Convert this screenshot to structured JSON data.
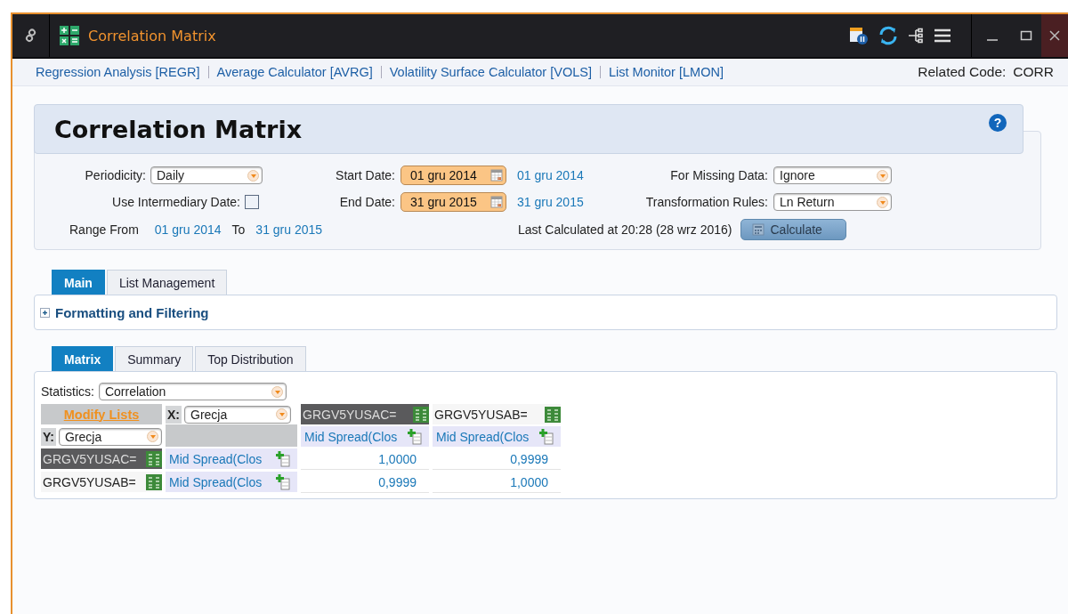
{
  "window": {
    "title": "Correlation Matrix"
  },
  "related_links": [
    "Regression Analysis [REGR]",
    "Average Calculator [AVRG]",
    "Volatility Surface Calculator [VOLS]",
    "List Monitor [LMON]"
  ],
  "related_code": {
    "label": "Related Code:",
    "value": "CORR"
  },
  "page_title": "Correlation Matrix",
  "help": "?",
  "form": {
    "periodicity": {
      "label": "Periodicity:",
      "value": "Daily"
    },
    "intermediary": {
      "label": "Use Intermediary Date:",
      "checked": false
    },
    "start_date": {
      "label": "Start Date:",
      "value": "01 gru 2014",
      "link": "01 gru 2014"
    },
    "end_date": {
      "label": "End Date:",
      "value": "31 gru 2015",
      "link": "31 gru 2015"
    },
    "missing_data": {
      "label": "For Missing Data:",
      "value": "Ignore"
    },
    "transformation": {
      "label": "Transformation Rules:",
      "value": "Ln Return"
    },
    "range": {
      "from_label": "Range From",
      "from": "01 gru 2014",
      "to_label": "To",
      "to": "31 gru 2015"
    },
    "last_calculated": "Last Calculated at 20:28 (28 wrz 2016)",
    "calculate": "Calculate"
  },
  "main_tabs": [
    {
      "label": "Main",
      "selected": true
    },
    {
      "label": "List Management",
      "selected": false
    }
  ],
  "section": {
    "label": "Formatting and Filtering",
    "expanded": false
  },
  "matrix_tabs": [
    {
      "label": "Matrix",
      "selected": true
    },
    {
      "label": "Summary",
      "selected": false
    },
    {
      "label": "Top Distribution",
      "selected": false
    }
  ],
  "statistics": {
    "label": "Statistics:",
    "value": "Correlation"
  },
  "matrix": {
    "modify_lists": "Modify Lists",
    "x": {
      "label": "X:",
      "value": "Grecja"
    },
    "y": {
      "label": "Y:",
      "value": "Grecja"
    },
    "columns": [
      {
        "code": "GRGV5YUSAC=",
        "field": "Mid Spread(Clos",
        "selected": true
      },
      {
        "code": "GRGV5YUSAB=",
        "field": "Mid Spread(Clos",
        "selected": false
      }
    ],
    "rows": [
      {
        "code": "GRGV5YUSAC=",
        "field": "Mid Spread(Clos",
        "selected": true,
        "values": [
          "1,0000",
          "0,9999"
        ]
      },
      {
        "code": "GRGV5YUSAB=",
        "field": "Mid Spread(Clos",
        "selected": false,
        "values": [
          "0,9999",
          "1,0000"
        ]
      }
    ]
  }
}
